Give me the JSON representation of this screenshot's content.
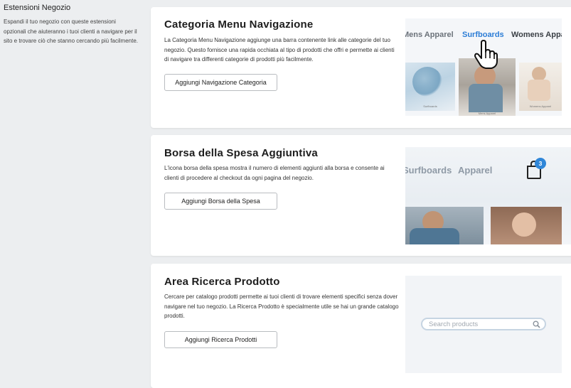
{
  "sidebar": {
    "title": "Estensioni Negozio",
    "description": "Espandi il tuo negozio con queste estensioni opzionali che aiuteranno i tuoi clienti a navigare per il sito e trovare ciò che stanno cercando più facilmente."
  },
  "cards": [
    {
      "title": "Categoria Menu Navigazione",
      "description": "La Categoria Menu Navigazione aggiunge una barra contenente link alle categorie del tuo negozio. Questo fornisce una rapida occhiata al tipo di prodotti che offri e permette ai clienti di navigare tra differenti categorie di prodotti più facilmente.",
      "button": "Aggiungi Navigazione Categoria",
      "preview": {
        "nav": [
          "Mens Apparel",
          "Surfboards",
          "Womens Apparel"
        ],
        "thumbs": [
          "Surfboards",
          "Mens Apparel",
          "Womens Apparel"
        ]
      }
    },
    {
      "title": "Borsa della Spesa Aggiuntiva",
      "description": "L'icona borsa della spesa mostra il numero di elementi aggiunti alla borsa e consente ai clienti di procedere al checkout da ogni pagina del negozio.",
      "button": "Aggiungi Borsa della Spesa",
      "preview": {
        "nav": [
          "Surfboards",
          "Apparel"
        ],
        "cart_count": "3"
      }
    },
    {
      "title": "Area Ricerca Prodotto",
      "description": "Cercare per catalogo prodotti permette ai tuoi clienti di trovare elementi specifici senza dover navigare nel tuo negozio. La Ricerca Prodotto è specialmente utile se hai un grande catalogo prodotti.",
      "button": "Aggiungi Ricerca Prodotti",
      "preview": {
        "search_placeholder": "Search products"
      }
    }
  ],
  "colors": {
    "page_bg": "#eceef0",
    "accent": "#2c7dd6",
    "badge": "#2f86d8"
  }
}
